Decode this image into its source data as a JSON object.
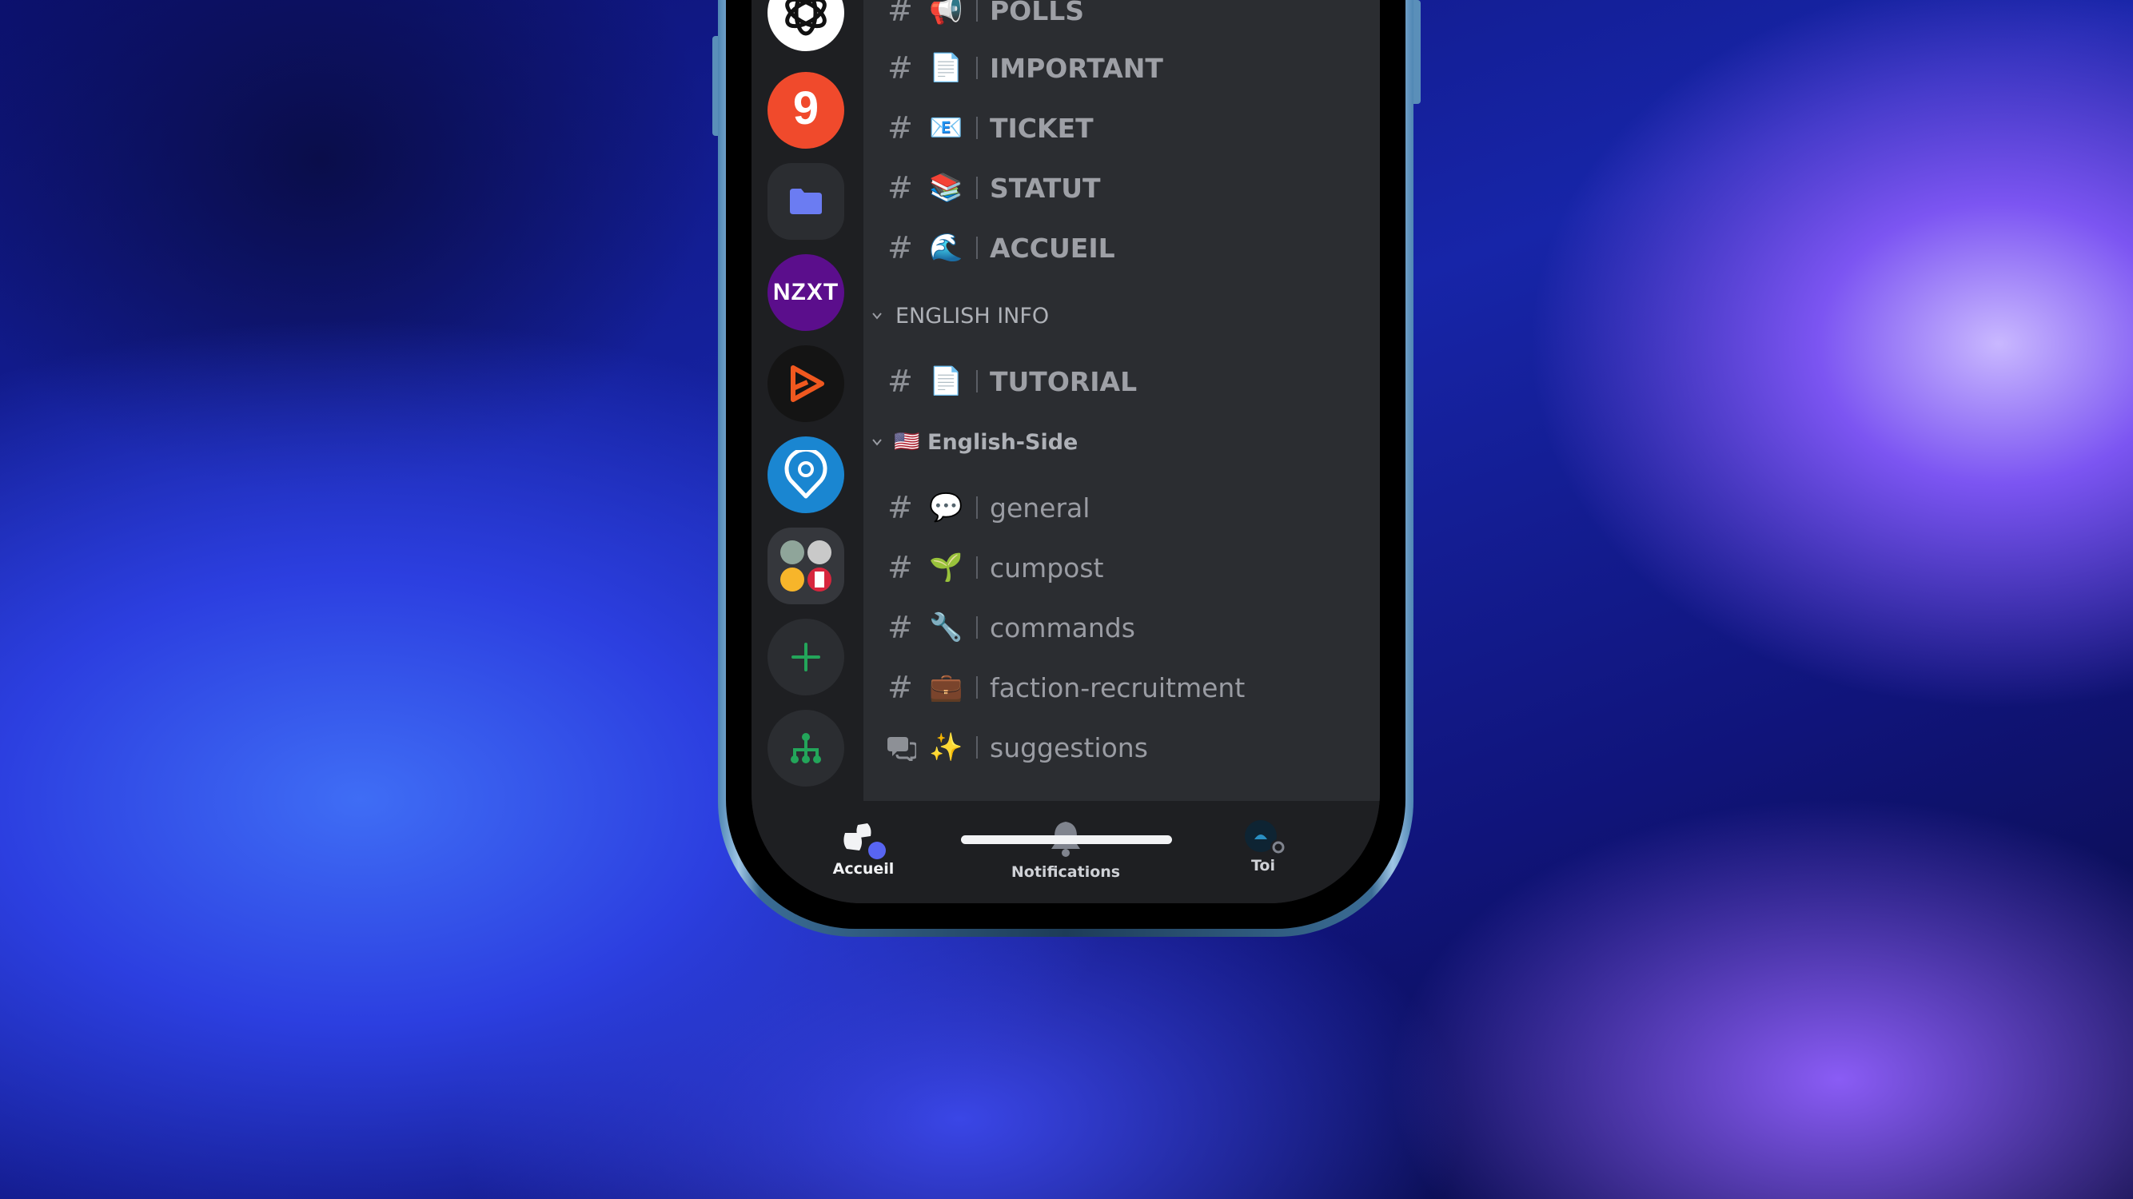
{
  "colors": {
    "panel_bg": "#2b2d31",
    "rail_bg": "#1e1f22",
    "channel_text": "#9a9ca3",
    "accent_blurple": "#5865f2",
    "add_server_green": "#23a55a"
  },
  "servers": [
    {
      "name": "chatgpt-server-icon"
    },
    {
      "name": "g-server-icon",
      "letter": "9"
    },
    {
      "name": "folder-server-icon"
    },
    {
      "name": "nzxt-server-icon",
      "text": "NZXT"
    },
    {
      "name": "play-server-icon"
    },
    {
      "name": "location-server-icon"
    },
    {
      "name": "server-folder-icon"
    }
  ],
  "rail_actions": {
    "add": "add-server-icon",
    "discover": "discover-hub-icon"
  },
  "channels_top": [
    {
      "emoji": "📢",
      "label": "POLLS"
    },
    {
      "emoji": "📄",
      "label": "IMPORTANT"
    },
    {
      "emoji": "📧",
      "label": "TICKET"
    },
    {
      "emoji": "📚",
      "label": "STATUT"
    },
    {
      "emoji": "🌊",
      "label": "ACCUEIL"
    }
  ],
  "category_english_info": {
    "label": "ENGLISH INFO"
  },
  "channels_english_info": [
    {
      "emoji": "📄",
      "label": "TUTORIAL"
    }
  ],
  "category_english_side": {
    "flag": "🇺🇸",
    "label": "English-Side"
  },
  "channels_english_side": [
    {
      "emoji": "💬",
      "label": "general"
    },
    {
      "emoji": "🌱",
      "label": "cumpost"
    },
    {
      "emoji": "🔧",
      "label": "commands"
    },
    {
      "emoji": "💼",
      "label": "faction-recruitment"
    },
    {
      "emoji": "✨",
      "label": "suggestions",
      "type": "forum"
    }
  ],
  "bottom_nav": {
    "home": "Accueil",
    "notifications": "Notifications",
    "you": "Toi"
  }
}
